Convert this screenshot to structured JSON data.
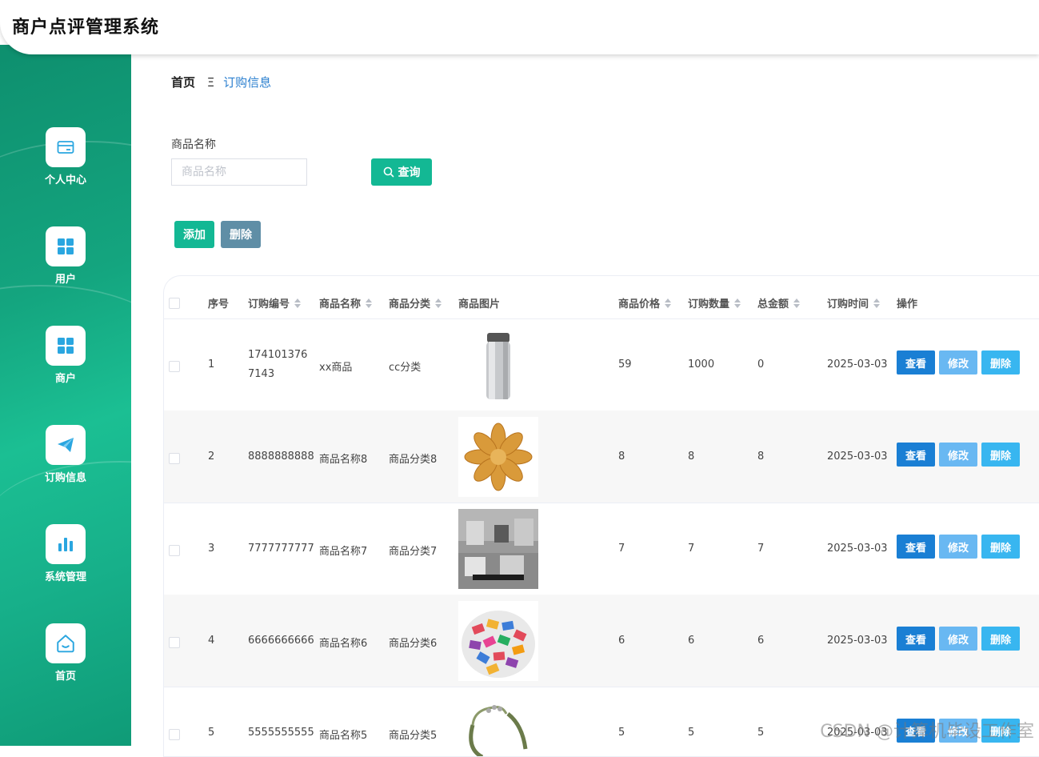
{
  "app": {
    "title": "商户点评管理系统"
  },
  "sidebar": {
    "items": [
      {
        "label": "个人中心",
        "icon": "card-icon"
      },
      {
        "label": "用户",
        "icon": "grid-icon"
      },
      {
        "label": "商户",
        "icon": "grid-icon"
      },
      {
        "label": "订购信息",
        "icon": "paper-plane-icon"
      },
      {
        "label": "系统管理",
        "icon": "bar-chart-icon"
      },
      {
        "label": "首页",
        "icon": "home-icon"
      }
    ]
  },
  "breadcrumb": {
    "home": "首页",
    "separator": "Ξ",
    "current": "订购信息"
  },
  "search": {
    "label": "商品名称",
    "placeholder": "商品名称",
    "button": "查询"
  },
  "toolbar": {
    "add": "添加",
    "delete": "删除"
  },
  "table": {
    "headers": [
      "序号",
      "订购编号",
      "商品名称",
      "商品分类",
      "商品图片",
      "商品价格",
      "订购数量",
      "总金额",
      "订购时间",
      "操作"
    ],
    "actions": {
      "view": "查看",
      "edit": "修改",
      "delete": "删除"
    },
    "rows": [
      {
        "index": "1",
        "order_no": "1741013767143",
        "name": "xx商品",
        "category": "cc分类",
        "image": "thermos-bottle",
        "price": "59",
        "quantity": "1000",
        "total": "0",
        "time": "2025-03-03"
      },
      {
        "index": "2",
        "order_no": "8888888888",
        "name": "商品名称8",
        "category": "商品分类8",
        "image": "dried-fruit",
        "price": "8",
        "quantity": "8",
        "total": "8",
        "time": "2025-03-03"
      },
      {
        "index": "3",
        "order_no": "7777777777",
        "name": "商品名称7",
        "category": "商品分类7",
        "image": "store-photo",
        "price": "7",
        "quantity": "7",
        "total": "7",
        "time": "2025-03-03"
      },
      {
        "index": "4",
        "order_no": "6666666666",
        "name": "商品名称6",
        "category": "商品分类6",
        "image": "candy-plate",
        "price": "6",
        "quantity": "6",
        "total": "6",
        "time": "2025-03-03"
      },
      {
        "index": "5",
        "order_no": "5555555555",
        "name": "商品名称5",
        "category": "商品分类5",
        "image": "bracelet",
        "price": "5",
        "quantity": "5",
        "total": "5",
        "time": "2025-03-03"
      }
    ]
  },
  "watermark": "CSDN @计算机毕设工作室",
  "colors": {
    "primary": "#13b894",
    "sidebar": "#14a57f",
    "link": "#2a7fcf",
    "view_button": "#1a7fd4",
    "edit_button": "#69b8f2",
    "delete_button": "#38b6f0"
  }
}
